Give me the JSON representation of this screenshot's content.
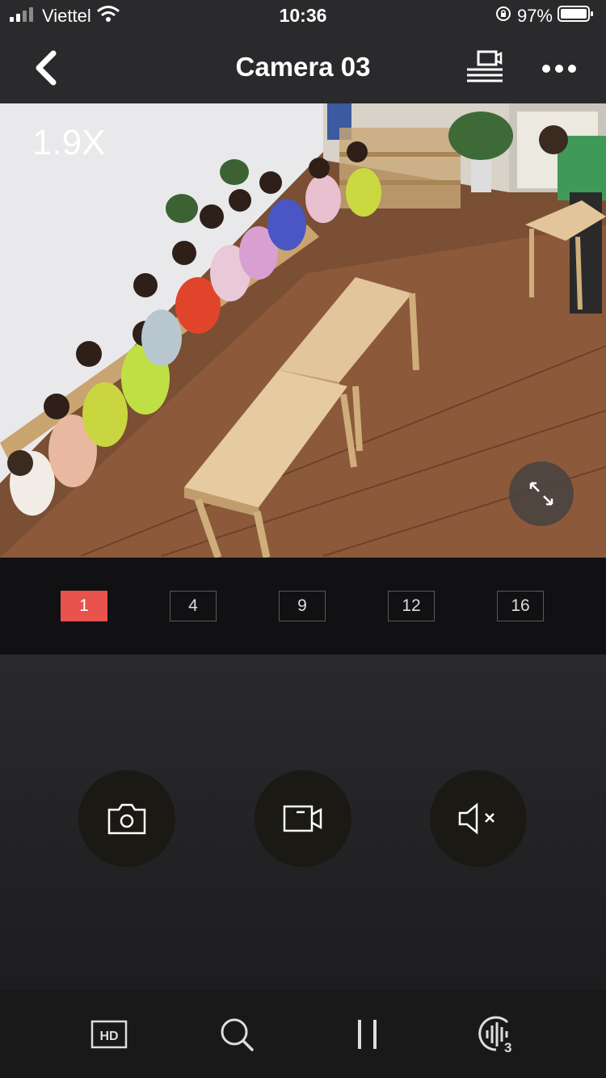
{
  "status_bar": {
    "carrier": "Viettel",
    "time": "10:36",
    "battery": "97%"
  },
  "nav": {
    "title": "Camera 03"
  },
  "video": {
    "zoom": "1.9X"
  },
  "layouts": {
    "options": [
      "1",
      "4",
      "9",
      "12",
      "16"
    ],
    "selected": "1"
  },
  "toolbar": {
    "audio_badge": "3"
  },
  "colors": {
    "accent": "#e8534d",
    "background": "#1d1d1f"
  },
  "icons": [
    "back-icon",
    "multi-screen-icon",
    "more-icon",
    "expand-icon",
    "snapshot-icon",
    "record-icon",
    "mute-icon",
    "hd-icon",
    "search-icon",
    "pause-icon",
    "audio-icon"
  ]
}
